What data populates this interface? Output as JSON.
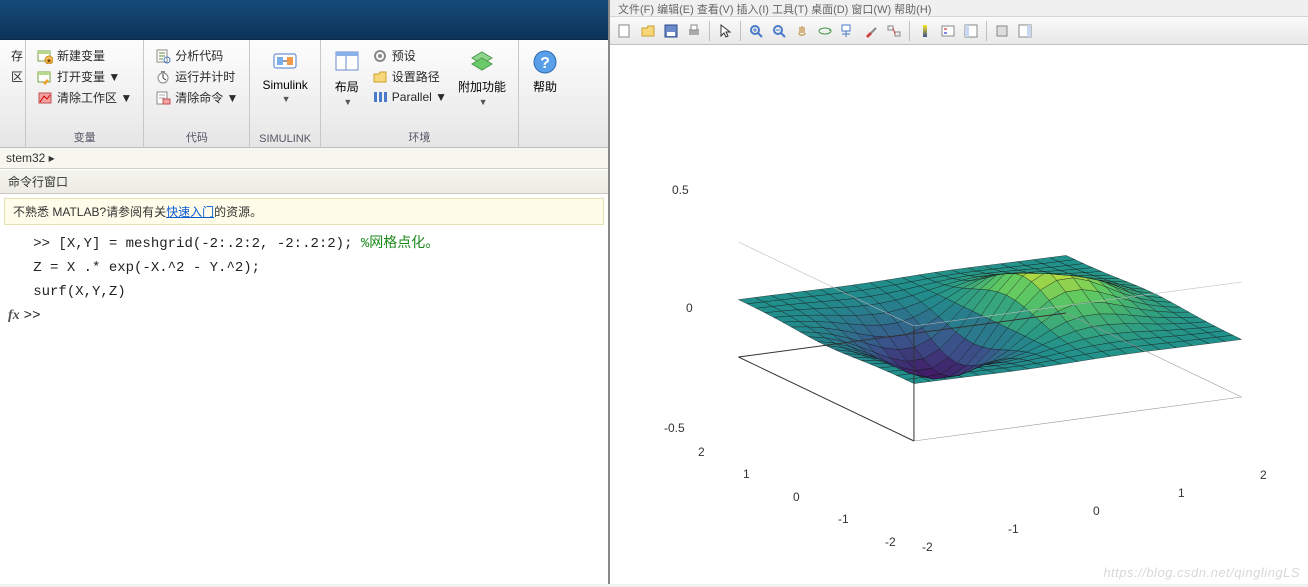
{
  "ribbon": {
    "groups": [
      {
        "title": "变量",
        "items": [
          "新建变量",
          "打开变量 ▼",
          "清除工作区 ▼"
        ],
        "left_items": [
          "存",
          "区"
        ]
      },
      {
        "title": "代码",
        "items": [
          "分析代码",
          "运行并计时",
          "清除命令 ▼"
        ]
      },
      {
        "title": "SIMULINK",
        "big": "Simulink"
      },
      {
        "title": "环境",
        "parts": {
          "layout": "布局",
          "pref": "预设",
          "setpath": "设置路径",
          "parallel": "Parallel ▼",
          "addons": "附加功能"
        }
      },
      {
        "title": "",
        "big": "帮助"
      }
    ]
  },
  "pathbar": "stem32 ▸",
  "cmd_title": "命令行窗口",
  "banner": {
    "pre": "不熟悉 MATLAB?请参阅有关",
    "link": "快速入门",
    "post": "的资源。"
  },
  "code": {
    "l1a": ">> [X,Y] = meshgrid(-2:.2:2, -2:.2:2); ",
    "l1b": "%网格点化。",
    "l2": "Z = X .* exp(-X.^2 - Y.^2);",
    "l3": "surf(X,Y,Z)",
    "prompt": ">> "
  },
  "fig_menu_hint": "文件(F)  编辑(E)  查看(V)  插入(I)  工具(T)  桌面(D)  窗口(W)  帮助(H)",
  "watermark": "https://blog.csdn.net/qinglingLS",
  "chart_data": {
    "type": "surface3d",
    "title": "",
    "x_range": [
      -2,
      2
    ],
    "x_step": 0.2,
    "y_range": [
      -2,
      2
    ],
    "y_step": 0.2,
    "z_range": [
      -0.5,
      0.5
    ],
    "x_ticks": [
      -2,
      -1,
      0,
      1,
      2
    ],
    "y_ticks": [
      -2,
      -1,
      0,
      1,
      2
    ],
    "z_ticks": [
      -0.5,
      0,
      0.5
    ],
    "formula": "Z = X .* exp(-X.^2 - Y.^2)",
    "colormap": "parula",
    "grid": true
  },
  "icons": {
    "newvar": "new-var-icon",
    "openvar": "open-var-icon",
    "clearws": "clear-workspace-icon",
    "analyze": "analyze-code-icon",
    "runtime": "run-timer-icon",
    "clearcmd": "clear-cmd-icon",
    "simulink": "simulink-icon",
    "layout": "layout-icon",
    "pref": "pref-icon",
    "setpath": "setpath-icon",
    "parallel": "parallel-icon",
    "addons": "addons-icon",
    "help": "help-icon"
  }
}
